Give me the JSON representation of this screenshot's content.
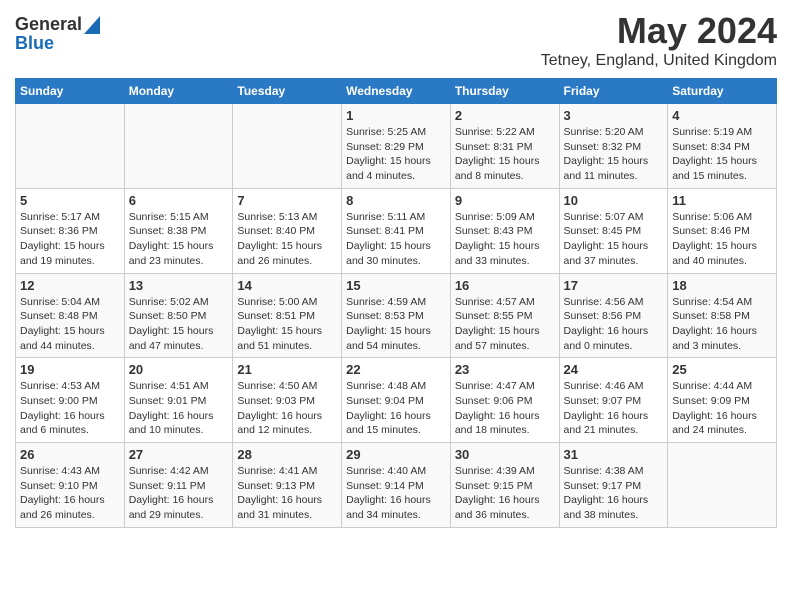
{
  "header": {
    "logo_general": "General",
    "logo_blue": "Blue",
    "title": "May 2024",
    "subtitle": "Tetney, England, United Kingdom"
  },
  "days_of_week": [
    "Sunday",
    "Monday",
    "Tuesday",
    "Wednesday",
    "Thursday",
    "Friday",
    "Saturday"
  ],
  "weeks": [
    [
      {
        "day": "",
        "content": ""
      },
      {
        "day": "",
        "content": ""
      },
      {
        "day": "",
        "content": ""
      },
      {
        "day": "1",
        "content": "Sunrise: 5:25 AM\nSunset: 8:29 PM\nDaylight: 15 hours\nand 4 minutes."
      },
      {
        "day": "2",
        "content": "Sunrise: 5:22 AM\nSunset: 8:31 PM\nDaylight: 15 hours\nand 8 minutes."
      },
      {
        "day": "3",
        "content": "Sunrise: 5:20 AM\nSunset: 8:32 PM\nDaylight: 15 hours\nand 11 minutes."
      },
      {
        "day": "4",
        "content": "Sunrise: 5:19 AM\nSunset: 8:34 PM\nDaylight: 15 hours\nand 15 minutes."
      }
    ],
    [
      {
        "day": "5",
        "content": "Sunrise: 5:17 AM\nSunset: 8:36 PM\nDaylight: 15 hours\nand 19 minutes."
      },
      {
        "day": "6",
        "content": "Sunrise: 5:15 AM\nSunset: 8:38 PM\nDaylight: 15 hours\nand 23 minutes."
      },
      {
        "day": "7",
        "content": "Sunrise: 5:13 AM\nSunset: 8:40 PM\nDaylight: 15 hours\nand 26 minutes."
      },
      {
        "day": "8",
        "content": "Sunrise: 5:11 AM\nSunset: 8:41 PM\nDaylight: 15 hours\nand 30 minutes."
      },
      {
        "day": "9",
        "content": "Sunrise: 5:09 AM\nSunset: 8:43 PM\nDaylight: 15 hours\nand 33 minutes."
      },
      {
        "day": "10",
        "content": "Sunrise: 5:07 AM\nSunset: 8:45 PM\nDaylight: 15 hours\nand 37 minutes."
      },
      {
        "day": "11",
        "content": "Sunrise: 5:06 AM\nSunset: 8:46 PM\nDaylight: 15 hours\nand 40 minutes."
      }
    ],
    [
      {
        "day": "12",
        "content": "Sunrise: 5:04 AM\nSunset: 8:48 PM\nDaylight: 15 hours\nand 44 minutes."
      },
      {
        "day": "13",
        "content": "Sunrise: 5:02 AM\nSunset: 8:50 PM\nDaylight: 15 hours\nand 47 minutes."
      },
      {
        "day": "14",
        "content": "Sunrise: 5:00 AM\nSunset: 8:51 PM\nDaylight: 15 hours\nand 51 minutes."
      },
      {
        "day": "15",
        "content": "Sunrise: 4:59 AM\nSunset: 8:53 PM\nDaylight: 15 hours\nand 54 minutes."
      },
      {
        "day": "16",
        "content": "Sunrise: 4:57 AM\nSunset: 8:55 PM\nDaylight: 15 hours\nand 57 minutes."
      },
      {
        "day": "17",
        "content": "Sunrise: 4:56 AM\nSunset: 8:56 PM\nDaylight: 16 hours\nand 0 minutes."
      },
      {
        "day": "18",
        "content": "Sunrise: 4:54 AM\nSunset: 8:58 PM\nDaylight: 16 hours\nand 3 minutes."
      }
    ],
    [
      {
        "day": "19",
        "content": "Sunrise: 4:53 AM\nSunset: 9:00 PM\nDaylight: 16 hours\nand 6 minutes."
      },
      {
        "day": "20",
        "content": "Sunrise: 4:51 AM\nSunset: 9:01 PM\nDaylight: 16 hours\nand 10 minutes."
      },
      {
        "day": "21",
        "content": "Sunrise: 4:50 AM\nSunset: 9:03 PM\nDaylight: 16 hours\nand 12 minutes."
      },
      {
        "day": "22",
        "content": "Sunrise: 4:48 AM\nSunset: 9:04 PM\nDaylight: 16 hours\nand 15 minutes."
      },
      {
        "day": "23",
        "content": "Sunrise: 4:47 AM\nSunset: 9:06 PM\nDaylight: 16 hours\nand 18 minutes."
      },
      {
        "day": "24",
        "content": "Sunrise: 4:46 AM\nSunset: 9:07 PM\nDaylight: 16 hours\nand 21 minutes."
      },
      {
        "day": "25",
        "content": "Sunrise: 4:44 AM\nSunset: 9:09 PM\nDaylight: 16 hours\nand 24 minutes."
      }
    ],
    [
      {
        "day": "26",
        "content": "Sunrise: 4:43 AM\nSunset: 9:10 PM\nDaylight: 16 hours\nand 26 minutes."
      },
      {
        "day": "27",
        "content": "Sunrise: 4:42 AM\nSunset: 9:11 PM\nDaylight: 16 hours\nand 29 minutes."
      },
      {
        "day": "28",
        "content": "Sunrise: 4:41 AM\nSunset: 9:13 PM\nDaylight: 16 hours\nand 31 minutes."
      },
      {
        "day": "29",
        "content": "Sunrise: 4:40 AM\nSunset: 9:14 PM\nDaylight: 16 hours\nand 34 minutes."
      },
      {
        "day": "30",
        "content": "Sunrise: 4:39 AM\nSunset: 9:15 PM\nDaylight: 16 hours\nand 36 minutes."
      },
      {
        "day": "31",
        "content": "Sunrise: 4:38 AM\nSunset: 9:17 PM\nDaylight: 16 hours\nand 38 minutes."
      },
      {
        "day": "",
        "content": ""
      }
    ]
  ]
}
